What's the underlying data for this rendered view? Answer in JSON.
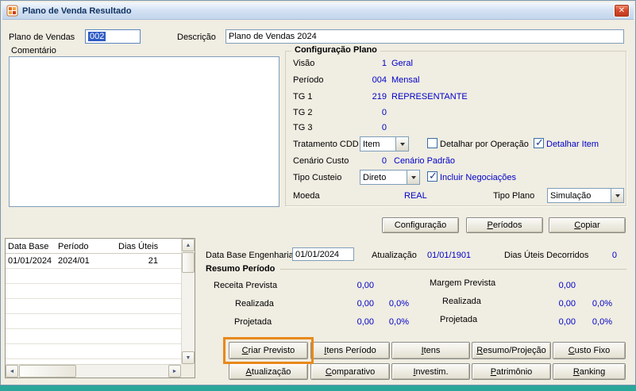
{
  "window": {
    "title": "Plano de Venda Resultado"
  },
  "icons": {
    "close": "✕",
    "scroll_up": "▲",
    "scroll_down": "▼",
    "scroll_left": "◄",
    "scroll_right": "►"
  },
  "colors": {
    "value_blue": "#0000c8",
    "annotation_orange": "#e8891b",
    "desktop_teal": "#2ba69b"
  },
  "header": {
    "plano_vendas_label": "Plano de Vendas",
    "plano_vendas_value": "002",
    "descricao_label": "Descrição",
    "descricao_value": "Plano de Vendas 2024"
  },
  "comentario": {
    "label": "Comentário",
    "value": ""
  },
  "config": {
    "title": "Configuração Plano",
    "visao": {
      "label": "Visão",
      "code": "1",
      "text": "Geral"
    },
    "periodo": {
      "label": "Período",
      "code": "004",
      "text": "Mensal"
    },
    "tg1": {
      "label": "TG 1",
      "code": "219",
      "text": "REPRESENTANTE"
    },
    "tg2": {
      "label": "TG 2",
      "code": "0",
      "text": ""
    },
    "tg3": {
      "label": "TG 3",
      "code": "0",
      "text": ""
    },
    "tratamento_cdd": {
      "label": "Tratamento CDD",
      "value": "Item"
    },
    "detalhar_operacao": {
      "label": "Detalhar por Operação",
      "checked": false
    },
    "detalhar_item": {
      "label": "Detalhar Item",
      "checked": true
    },
    "cenario_custo": {
      "label": "Cenário Custo",
      "code": "0",
      "text": "Cenário Padrão"
    },
    "tipo_custeio": {
      "label": "Tipo Custeio",
      "value": "Direto"
    },
    "incluir_negociacoes": {
      "label": "Incluir Negociações",
      "checked": true
    },
    "moeda": {
      "label": "Moeda",
      "value": "REAL"
    },
    "tipo_plano": {
      "label": "Tipo Plano",
      "value": "Simulação"
    }
  },
  "mid_buttons": {
    "configuracao": "Configuração",
    "periodos": "Períodos",
    "copiar": "Copiar"
  },
  "grid": {
    "headers": [
      "Data Base",
      "Período",
      "Dias Úteis"
    ],
    "row1": {
      "data_base": "01/01/2024",
      "periodo": "2024/01",
      "dias_uteis": "21"
    }
  },
  "engenharia": {
    "data_base_label": "Data Base Engenharia",
    "data_base_value": "01/01/2024",
    "atualizacao_label": "Atualização",
    "atualizacao_value": "01/01/1901",
    "dias_uteis_label": "Dias Úteis Decorridos",
    "dias_uteis_value": "0"
  },
  "resumo": {
    "title": "Resumo Período",
    "receita_prevista_label": "Receita Prevista",
    "receita_prevista_value": "0,00",
    "realizada_label": "Realizada",
    "realizada_value": "0,00",
    "realizada_pct": "0,0%",
    "projetada_label": "Projetada",
    "projetada_value": "0,00",
    "projetada_pct": "0,0%",
    "margem_prevista_label": "Margem Prevista",
    "margem_prevista_value": "0,00",
    "margem_realizada_label": "Realizada",
    "margem_realizada_value": "0,00",
    "margem_realizada_pct": "0,0%",
    "margem_projetada_label": "Projetada",
    "margem_projetada_value": "0,00",
    "margem_projetada_pct": "0,0%"
  },
  "buttons": {
    "criar_previsto": "Criar Previsto",
    "itens_periodo": "Itens Período",
    "itens": "Itens",
    "resumo_projecao": "Resumo/Projeção",
    "custo_fixo": "Custo Fixo",
    "atualizacao": "Atualização",
    "comparativo": "Comparativo",
    "investim": "Investim.",
    "patrimonio": "Patrimônio",
    "ranking": "Ranking"
  }
}
